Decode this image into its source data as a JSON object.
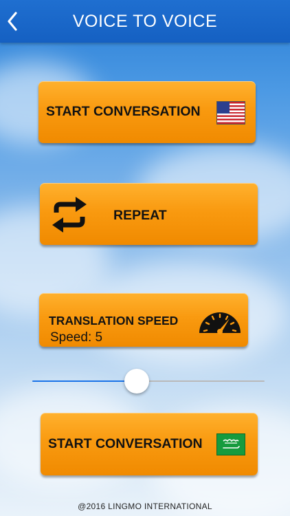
{
  "header": {
    "title": "VOICE TO VOICE",
    "back_icon": "chevron-left-icon"
  },
  "buttons": {
    "start_conversation_top": {
      "label": "START CONVERSATION",
      "icon": "us-flag-icon"
    },
    "repeat": {
      "label": "REPEAT",
      "icon": "repeat-icon"
    },
    "translation_speed": {
      "label": "TRANSLATION SPEED",
      "speed_text": "Speed: 5",
      "icon": "speedometer-icon"
    },
    "start_conversation_bottom": {
      "label": "START CONVERSATION",
      "icon": "saudi-flag-icon"
    }
  },
  "slider": {
    "value_fraction": 0.45
  },
  "footer": {
    "text": "@2016 LINGMO INTERNATIONAL"
  },
  "colors": {
    "header": "#1560c2",
    "button_orange": "#f99a10",
    "slider_fill": "#1a73e8",
    "slider_track": "#b9b9b9"
  }
}
